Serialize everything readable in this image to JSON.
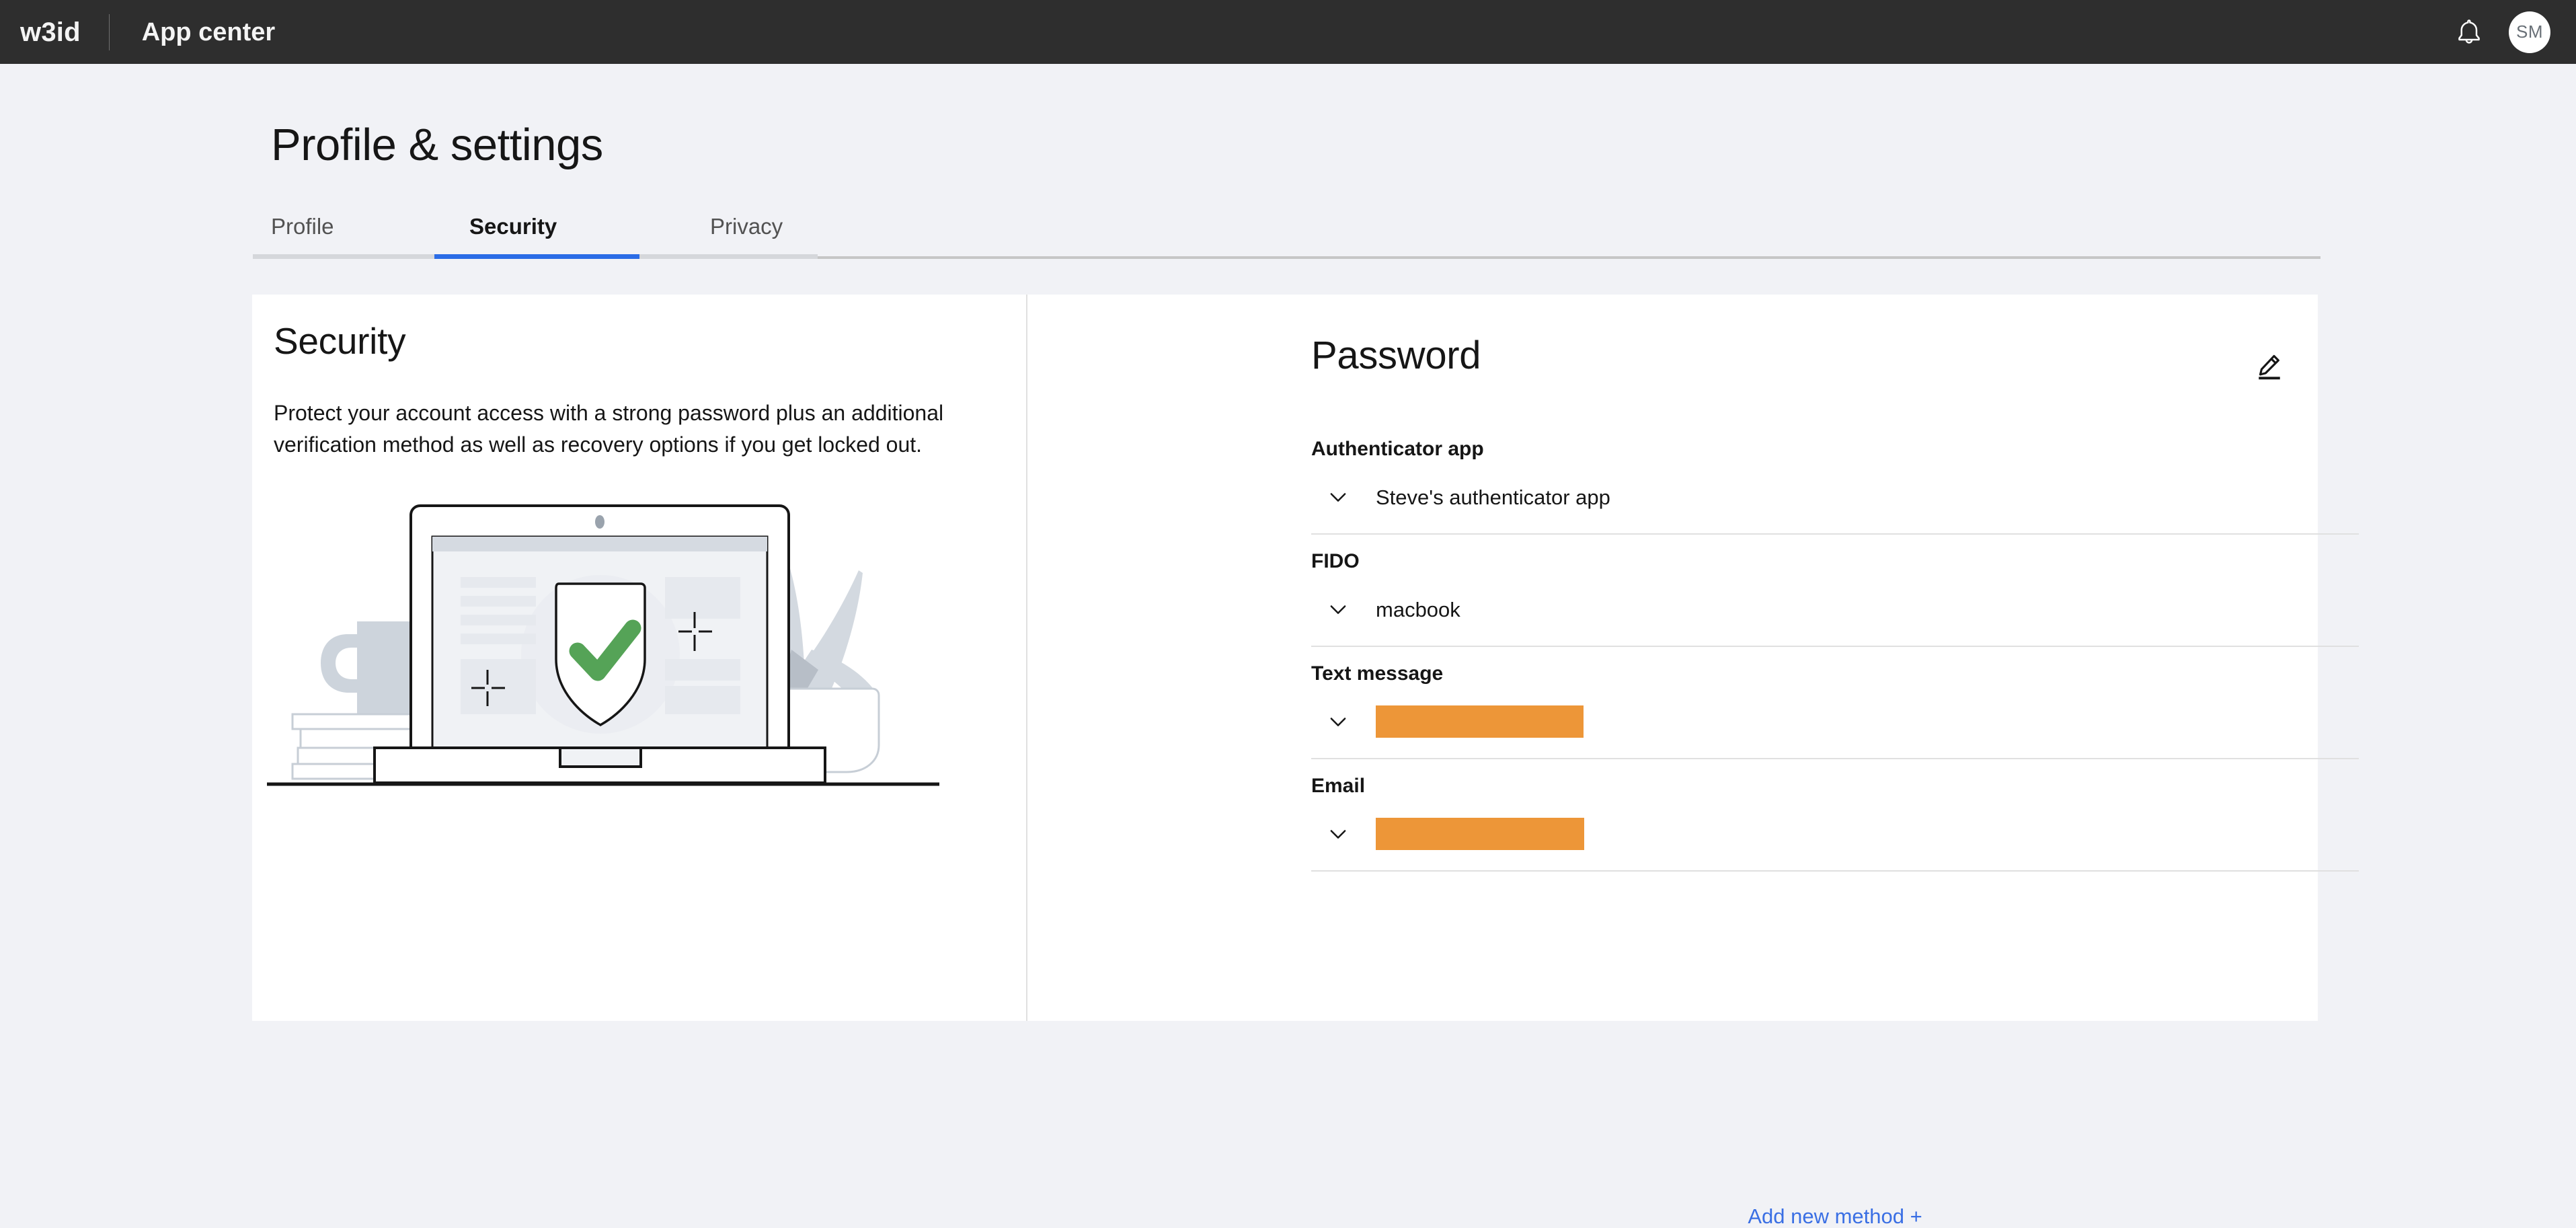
{
  "topnav": {
    "brand": "w3id",
    "app_name": "App center",
    "notifications_icon": "bell-icon",
    "avatar_initials": "SM"
  },
  "page": {
    "title": "Profile & settings",
    "tabs": [
      {
        "label": "Profile",
        "active": false
      },
      {
        "label": "Security",
        "active": true
      },
      {
        "label": "Privacy",
        "active": false
      }
    ]
  },
  "security_panel": {
    "heading": "Security",
    "description": "Protect your account access with a strong password plus an additional verification method as well as recovery options if you get locked out.",
    "illustration": "laptop-shield-checkmark-illustration"
  },
  "password_panel": {
    "heading": "Password",
    "edit_icon": "edit-pencil-icon",
    "methods": [
      {
        "label": "Authenticator app",
        "value": "Steve's authenticator app",
        "redacted": false,
        "chevron": "chevron-down-icon"
      },
      {
        "label": "FIDO",
        "value": "macbook",
        "redacted": false,
        "chevron": "chevron-down-icon"
      },
      {
        "label": "Text message",
        "value": "",
        "redacted": true,
        "chevron": "chevron-down-icon"
      },
      {
        "label": "Email",
        "value": "",
        "redacted": true,
        "chevron": "chevron-down-icon"
      }
    ],
    "add_method_label": "Add new method +"
  },
  "colors": {
    "nav_background": "#2E2E2E",
    "page_background": "#F1F2F6",
    "card_background": "#FFFFFF",
    "accent_blue": "#2B6CE6",
    "link_blue": "#3A6FE4",
    "redaction_orange": "#ED9638",
    "shield_check_green": "#55A357"
  }
}
